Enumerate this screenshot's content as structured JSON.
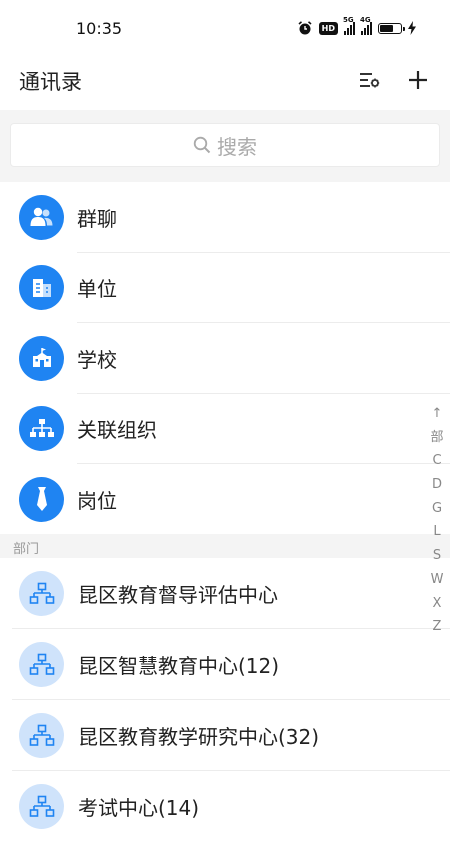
{
  "status_bar": {
    "time": "10:35",
    "hd_label": "HD",
    "signal1_tag": "5G",
    "signal2_tag": "4G",
    "battery_level": 0.7
  },
  "header": {
    "title": "通讯录",
    "settings_icon": "filter-settings-icon",
    "add_icon": "plus-icon"
  },
  "search": {
    "placeholder": "搜索",
    "icon": "search-icon"
  },
  "menu": [
    {
      "label": "群聊",
      "icon": "group-chat-icon"
    },
    {
      "label": "单位",
      "icon": "building-icon"
    },
    {
      "label": "学校",
      "icon": "school-icon"
    },
    {
      "label": "关联组织",
      "icon": "org-chart-icon"
    },
    {
      "label": "岗位",
      "icon": "tie-icon"
    }
  ],
  "section": {
    "title": "部门"
  },
  "departments": [
    {
      "label": "昆区教育督导评估中心",
      "icon": "org-chart-icon"
    },
    {
      "label": "昆区智慧教育中心(12)",
      "icon": "org-chart-icon"
    },
    {
      "label": "昆区教育教学研究中心(32)",
      "icon": "org-chart-icon"
    },
    {
      "label": "考试中心(14)",
      "icon": "org-chart-icon"
    }
  ],
  "index_bar": [
    "↑",
    "部",
    "C",
    "D",
    "G",
    "L",
    "S",
    "W",
    "X",
    "Z"
  ],
  "colors": {
    "accent": "#1f84f2",
    "accent_light": "#cfe3fb",
    "background_gray": "#f4f4f4"
  }
}
